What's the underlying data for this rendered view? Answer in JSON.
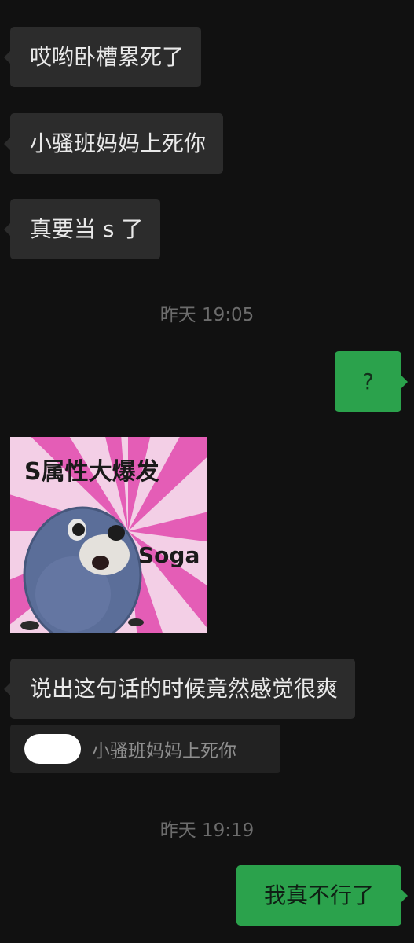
{
  "messages": {
    "m1": "哎哟卧槽累死了",
    "m2": "小骚班妈妈上死你",
    "m3": "真要当 s 了",
    "m4": "?",
    "m5": "说出这句话的时候竟然感觉很爽",
    "m6": "我真不行了"
  },
  "timestamps": {
    "t1": "昨天 19:05",
    "t2": "昨天 19:19"
  },
  "sticker": {
    "title": "S属性大爆发",
    "caption": "Soga"
  },
  "quote": {
    "text": "小骚班妈妈上死你"
  },
  "colors": {
    "background": "#111111",
    "incoming_bubble": "#2c2c2c",
    "outgoing_bubble": "#2ba24c",
    "timestamp": "#6c6c6c"
  }
}
